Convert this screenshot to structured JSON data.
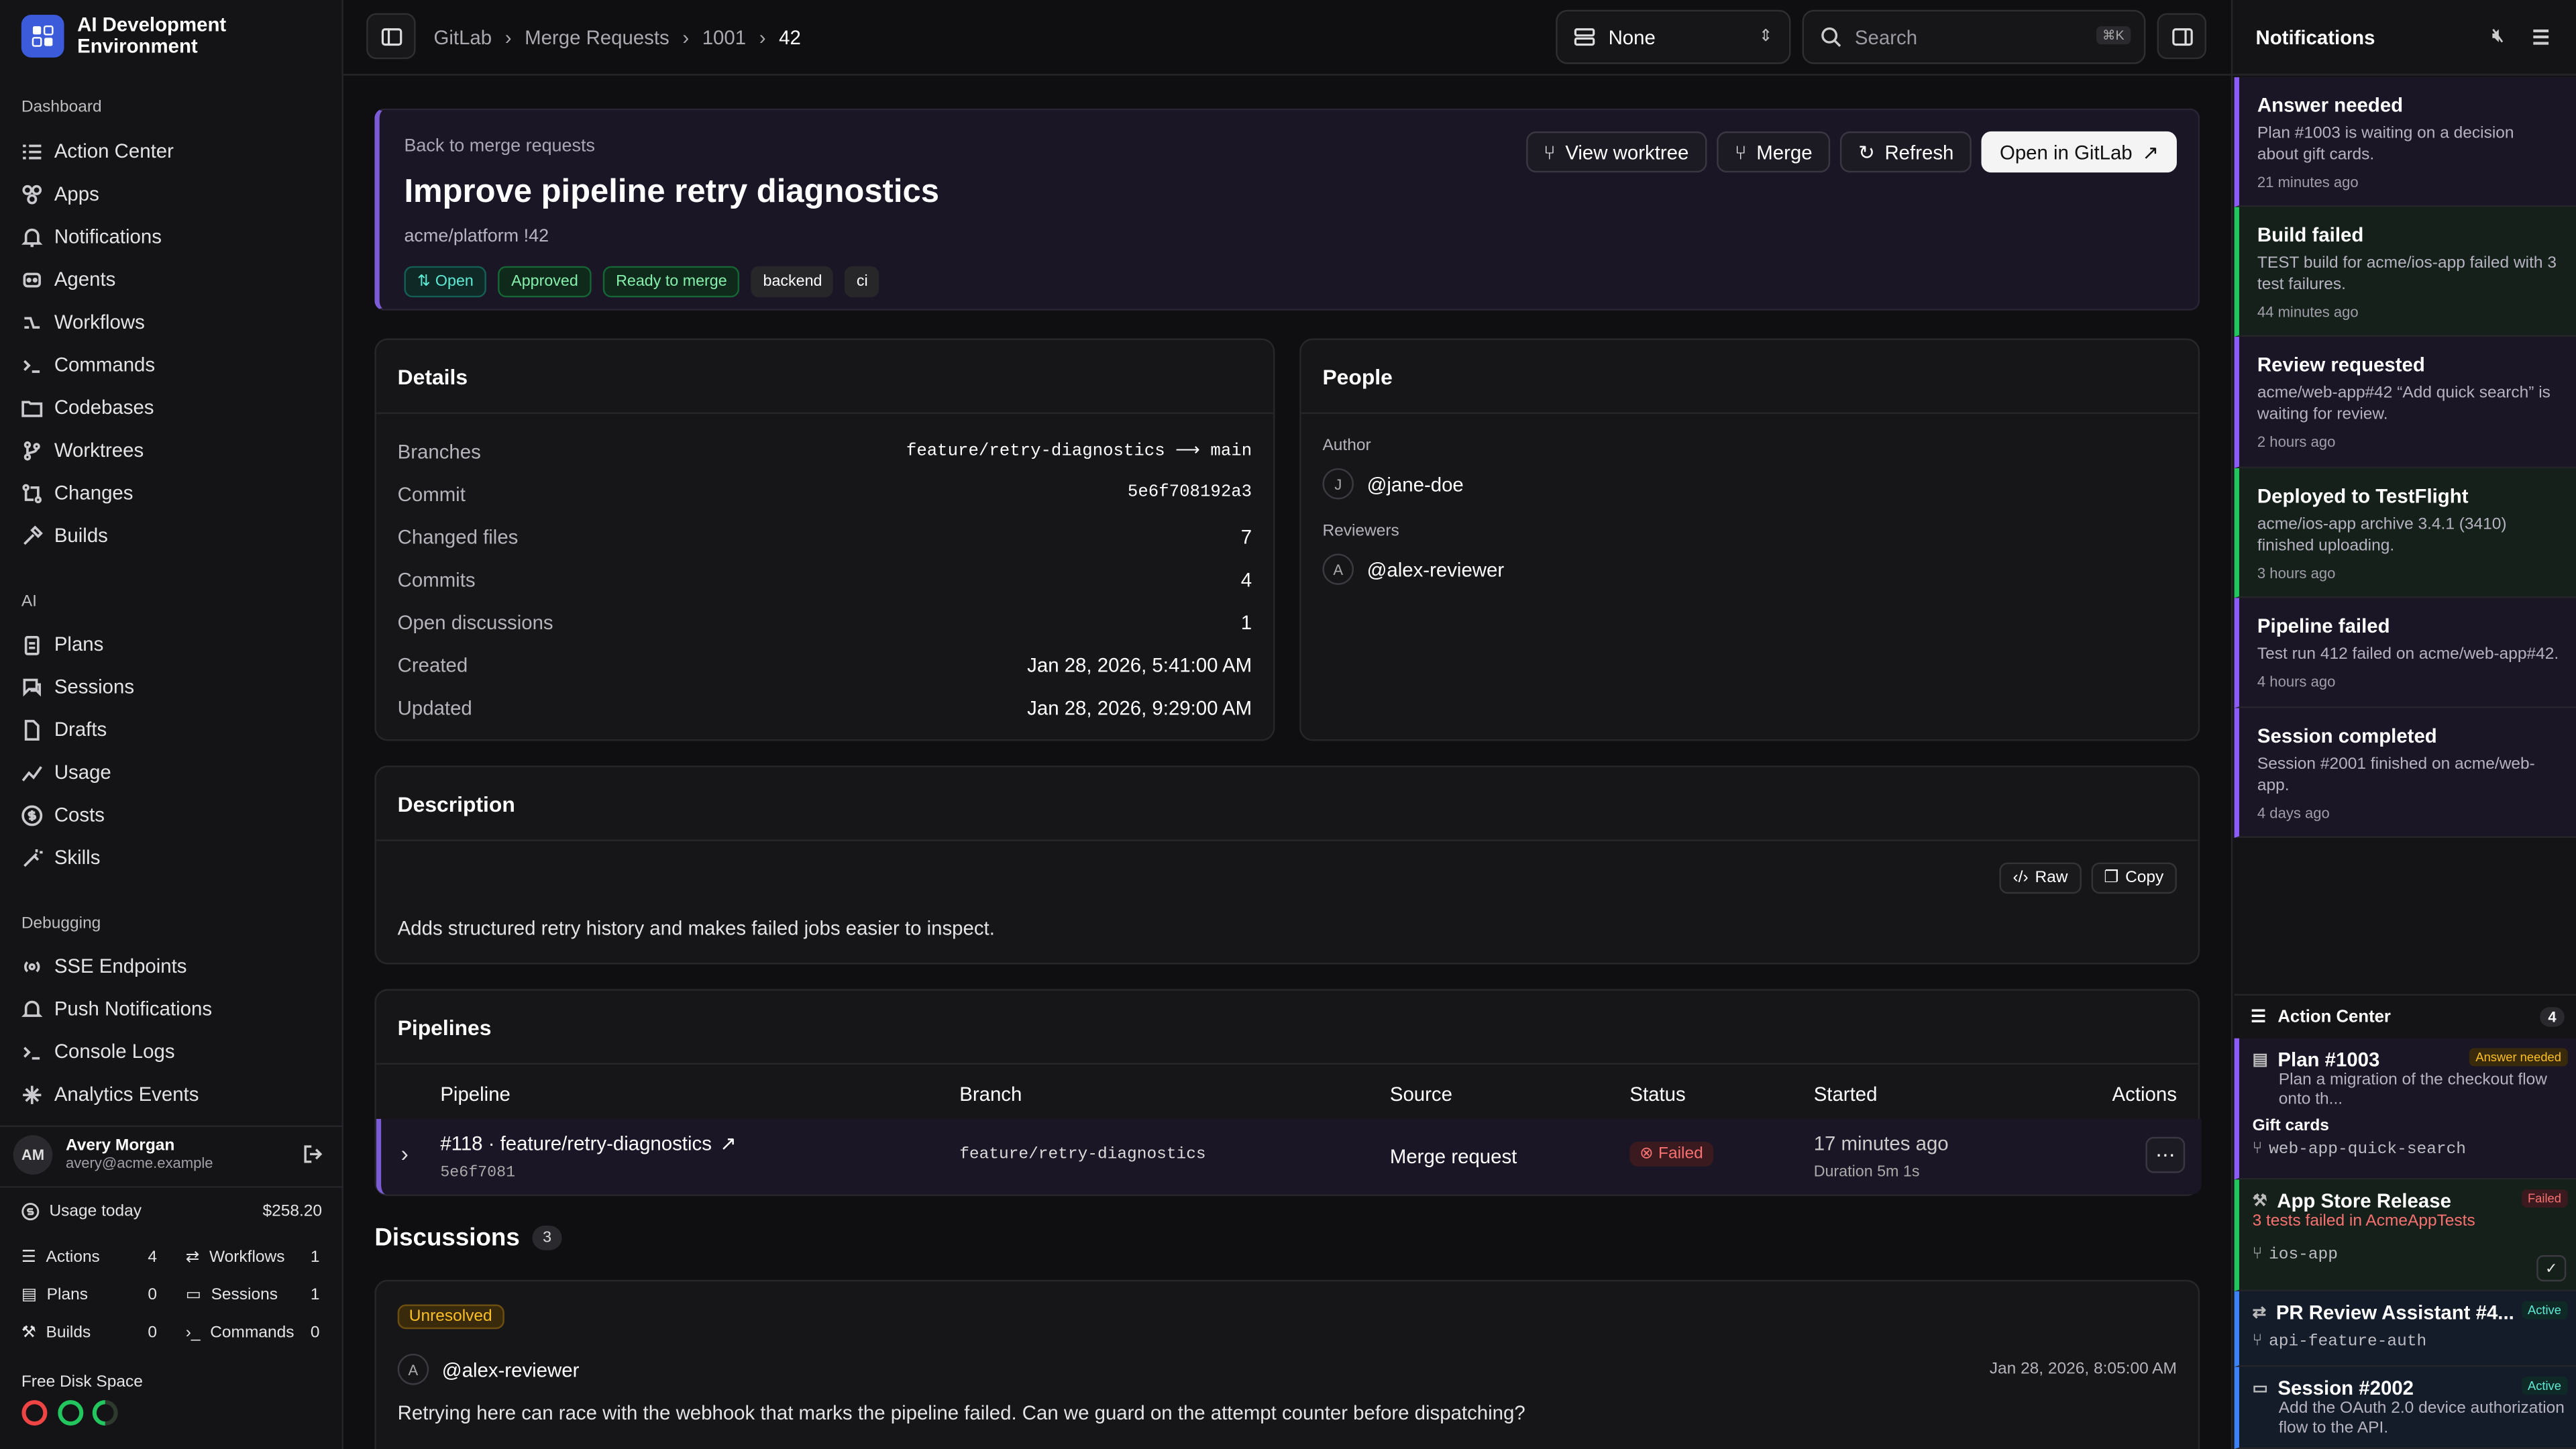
{
  "app": {
    "title": "AI Development Environment"
  },
  "sidebar": {
    "dashboard_label": "Dashboard",
    "dashboard_items": [
      {
        "label": "Action Center"
      },
      {
        "label": "Apps"
      },
      {
        "label": "Notifications"
      },
      {
        "label": "Agents"
      },
      {
        "label": "Workflows"
      },
      {
        "label": "Commands"
      },
      {
        "label": "Codebases"
      },
      {
        "label": "Worktrees"
      },
      {
        "label": "Changes"
      },
      {
        "label": "Builds"
      }
    ],
    "ai_label": "AI",
    "ai_items": [
      {
        "label": "Plans"
      },
      {
        "label": "Sessions"
      },
      {
        "label": "Drafts"
      },
      {
        "label": "Usage"
      },
      {
        "label": "Costs"
      },
      {
        "label": "Skills"
      }
    ],
    "debug_label": "Debugging",
    "debug_items": [
      {
        "label": "SSE Endpoints"
      },
      {
        "label": "Push Notifications"
      },
      {
        "label": "Console Logs"
      },
      {
        "label": "Analytics Events"
      }
    ]
  },
  "user": {
    "initials": "AM",
    "name": "Avery Morgan",
    "email": "avery@acme.example"
  },
  "usage": {
    "label": "Usage today",
    "value": "$258.20",
    "stats": [
      {
        "label": "Actions",
        "value": "4"
      },
      {
        "label": "Workflows",
        "value": "1"
      },
      {
        "label": "Plans",
        "value": "0"
      },
      {
        "label": "Sessions",
        "value": "1"
      },
      {
        "label": "Builds",
        "value": "0"
      },
      {
        "label": "Commands",
        "value": "0"
      }
    ],
    "disk_label": "Free Disk Space"
  },
  "topbar": {
    "breadcrumb": [
      "GitLab",
      "Merge Requests",
      "1001",
      "42"
    ],
    "select_value": "None",
    "search_placeholder": "Search",
    "search_shortcut": "⌘K"
  },
  "mr": {
    "back": "Back to merge requests",
    "title": "Improve pipeline retry diagnostics",
    "repo": "acme/platform !42",
    "tags": [
      "Open",
      "Approved",
      "Ready to merge",
      "backend",
      "ci"
    ],
    "buttons": {
      "worktree": "View worktree",
      "merge": "Merge",
      "refresh": "Refresh",
      "open": "Open in GitLab"
    }
  },
  "details": {
    "title": "Details",
    "rows": [
      {
        "k": "Branches",
        "v": "feature/retry-diagnostics ⟶ main"
      },
      {
        "k": "Commit",
        "v": "5e6f708192a3"
      },
      {
        "k": "Changed files",
        "v": "7"
      },
      {
        "k": "Commits",
        "v": "4"
      },
      {
        "k": "Open discussions",
        "v": "1"
      },
      {
        "k": "Created",
        "v": "Jan 28, 2026, 5:41:00 AM"
      },
      {
        "k": "Updated",
        "v": "Jan 28, 2026, 9:29:00 AM"
      }
    ]
  },
  "people": {
    "title": "People",
    "author_label": "Author",
    "author": {
      "initial": "J",
      "name": "@jane-doe"
    },
    "reviewers_label": "Reviewers",
    "reviewer": {
      "initial": "A",
      "name": "@alex-reviewer"
    }
  },
  "description": {
    "title": "Description",
    "raw": "Raw",
    "copy": "Copy",
    "text": "Adds structured retry history and makes failed jobs easier to inspect."
  },
  "pipelines": {
    "title": "Pipelines",
    "headers": [
      "Pipeline",
      "Branch",
      "Source",
      "Status",
      "Started",
      "Actions"
    ],
    "row": {
      "name": "#118 · feature/retry-diagnostics",
      "sha": "5e6f7081",
      "branch": "feature/retry-diagnostics",
      "source": "Merge request",
      "status": "Failed",
      "started": "17 minutes ago",
      "duration": "Duration 5m 1s"
    }
  },
  "discussions": {
    "title": "Discussions",
    "count": "3",
    "badge": "Unresolved",
    "author_initial": "A",
    "author": "@alex-reviewer",
    "date": "Jan 28, 2026, 8:05:00 AM",
    "text": "Retrying here can race with the webhook that marks the pipeline failed. Can we guard on the attempt counter before dispatching?"
  },
  "notifications": {
    "title": "Notifications",
    "items": [
      {
        "title": "Answer needed",
        "desc": "Plan #1003 is waiting on a decision about gift cards.",
        "time": "21 minutes ago",
        "color": "#8b5cf6"
      },
      {
        "title": "Build failed",
        "desc": "TEST build for acme/ios-app failed with 3 test failures.",
        "time": "44 minutes ago",
        "color": "#22c55e"
      },
      {
        "title": "Review requested",
        "desc": "acme/web-app#42 “Add quick search” is waiting for review.",
        "time": "2 hours ago",
        "color": "#8b5cf6"
      },
      {
        "title": "Deployed to TestFlight",
        "desc": "acme/ios-app archive 3.4.1 (3410) finished uploading.",
        "time": "3 hours ago",
        "color": "#22c55e"
      },
      {
        "title": "Pipeline failed",
        "desc": "Test run 412 failed on acme/web-app#42.",
        "time": "4 hours ago",
        "color": "#8b5cf6"
      },
      {
        "title": "Session completed",
        "desc": "Session #2001 finished on acme/web-app.",
        "time": "4 days ago",
        "color": "#8b5cf6"
      }
    ]
  },
  "action_center": {
    "title": "Action Center",
    "count": "4",
    "items": [
      {
        "title": "Plan #1003",
        "badge": "Answer needed",
        "desc": "Plan a migration of the checkout flow onto th...",
        "extra": "Gift cards",
        "branch": "web-app-quick-search"
      },
      {
        "title": "App Store Release",
        "badge": "Failed",
        "desc": "3 tests failed in AcmeAppTests",
        "branch": "ios-app"
      },
      {
        "title": "PR Review Assistant #4...",
        "badge": "Active",
        "branch": "api-feature-auth"
      },
      {
        "title": "Session #2002",
        "badge": "Active",
        "desc": "Add the OAuth 2.0 device authorization flow to the API."
      }
    ]
  }
}
